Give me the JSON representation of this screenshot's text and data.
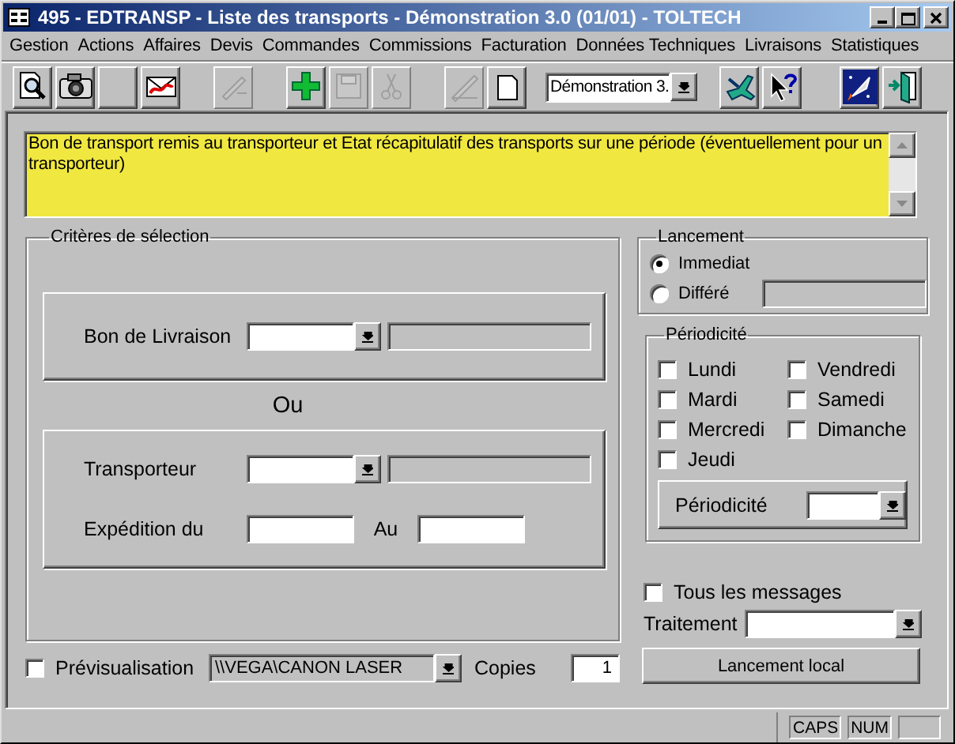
{
  "window": {
    "title": "495 - EDTRANSP - Liste des transports - Démonstration 3.0 (01/01) - TOLTECH"
  },
  "menu": [
    "Gestion",
    "Actions",
    "Affaires",
    "Devis",
    "Commandes",
    "Commissions",
    "Facturation",
    "Données Techniques",
    "Livraisons",
    "Statistiques"
  ],
  "toolbar": [
    [
      {
        "kind": "button",
        "disabled": false
      },
      {
        "kind": "button",
        "disabled": false
      },
      {
        "kind": "button",
        "disabled": false
      },
      {
        "kind": "button",
        "disabled": false
      }
    ],
    [
      {
        "kind": "button",
        "disabled": true
      }
    ],
    [
      {
        "kind": "button",
        "disabled": false
      },
      {
        "kind": "button",
        "disabled": true
      },
      {
        "kind": "button",
        "disabled": true
      }
    ],
    [
      {
        "kind": "button",
        "disabled": true
      },
      {
        "kind": "button",
        "disabled": false
      }
    ],
    [
      {
        "kind": "dropdown",
        "value": "Démonstration 3."
      }
    ],
    [
      {
        "kind": "button",
        "disabled": false
      },
      {
        "kind": "button",
        "disabled": false
      }
    ],
    [
      {
        "kind": "button",
        "disabled": false
      },
      {
        "kind": "button",
        "disabled": false
      }
    ]
  ],
  "description": "Bon de transport remis au transporteur et Etat récapitulatif des transports sur une période (éventuellement pour un transporteur)",
  "criteria": {
    "title": "Critères de sélection",
    "delivery_note": {
      "label": "Bon de Livraison"
    },
    "separator": "Ou",
    "carrier": {
      "label": "Transporteur"
    },
    "shipping": {
      "label": "Expédition du",
      "to_label": "Au"
    }
  },
  "preview": {
    "label": "Prévisualisation",
    "checked": false
  },
  "printer": {
    "value": "\\\\VEGA\\CANON LASER"
  },
  "copies": {
    "label": "Copies",
    "value": "1"
  },
  "launch": {
    "title": "Lancement",
    "options": [
      {
        "label": "Immediat",
        "selected": true
      },
      {
        "label": "Différé",
        "selected": false
      }
    ]
  },
  "periodicity": {
    "title": "Périodicité",
    "days": [
      {
        "label": "Lundi",
        "checked": false
      },
      {
        "label": "Mardi",
        "checked": false
      },
      {
        "label": "Mercredi",
        "checked": false
      },
      {
        "label": "Jeudi",
        "checked": false
      },
      {
        "label": "Vendredi",
        "checked": false
      },
      {
        "label": "Samedi",
        "checked": false
      },
      {
        "label": "Dimanche",
        "checked": false
      }
    ],
    "frequency_label": "Périodicité"
  },
  "all_messages": {
    "label": "Tous les messages",
    "checked": false
  },
  "processing": {
    "label": "Traitement"
  },
  "run_button": "Lancement local",
  "status_bar": {
    "indicators": [
      "CAPS",
      "NUM"
    ]
  }
}
